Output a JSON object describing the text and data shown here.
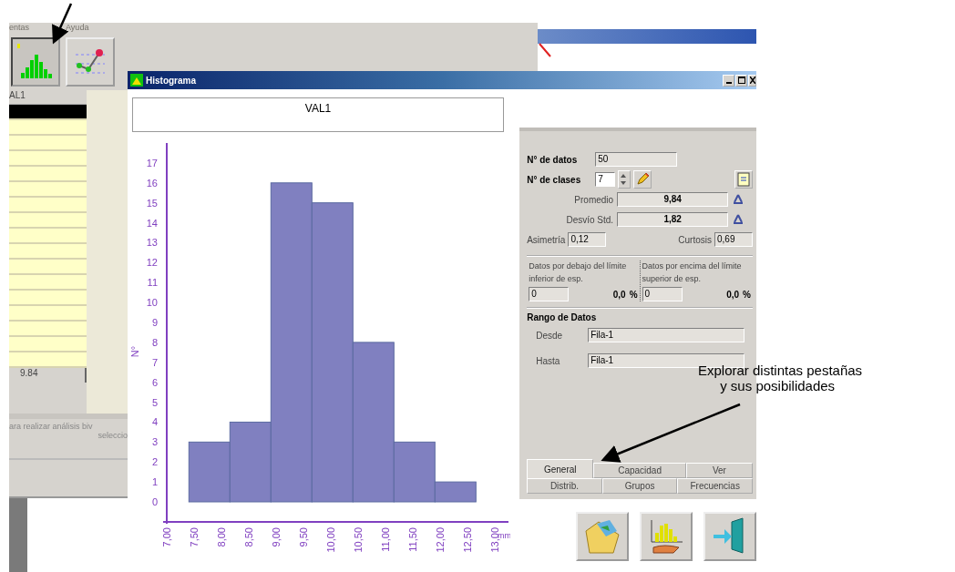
{
  "background_window": {
    "menu": [
      "entas",
      "Ayuda"
    ],
    "toolbar": [
      {
        "kind": "histogram",
        "selected": true
      },
      {
        "kind": "control_chart",
        "selected": false
      }
    ],
    "grid": {
      "column_header": "AL1",
      "rows": [
        {
          "selected": true
        },
        {
          "selected": false
        },
        {
          "selected": false
        },
        {
          "selected": false
        },
        {
          "selected": false
        },
        {
          "selected": false
        },
        {
          "selected": false
        },
        {
          "selected": false
        },
        {
          "selected": false
        },
        {
          "selected": false
        },
        {
          "selected": false
        },
        {
          "selected": false
        },
        {
          "selected": false
        },
        {
          "selected": false
        },
        {
          "selected": false
        },
        {
          "selected": false
        },
        {
          "selected": false
        }
      ],
      "footer": "9.84"
    },
    "hint": [
      "ara realizar análisis biv",
      "seleccio"
    ]
  },
  "histogram_window": {
    "title": "Histograma",
    "chart_title": "VAL1",
    "chart": {
      "chart_data": {
        "type": "bar",
        "ylabel": "N°",
        "xlabel": "mm",
        "x": [
          7.78,
          8.53,
          9.28,
          10.03,
          10.78,
          11.53,
          12.28
        ],
        "values": [
          3,
          4,
          16,
          15,
          8,
          3,
          1
        ],
        "xlim": [
          7,
          13.25
        ],
        "ylim": [
          0,
          18
        ],
        "xticks": [
          {
            "value": 7,
            "label": "7,00"
          },
          {
            "value": 7.5,
            "label": "7,50"
          },
          {
            "value": 8,
            "label": "8,00"
          },
          {
            "value": 8.5,
            "label": "8,50"
          },
          {
            "value": 9,
            "label": "9,00"
          },
          {
            "value": 9.5,
            "label": "9,50"
          },
          {
            "value": 10,
            "label": "10,00"
          },
          {
            "value": 10.5,
            "label": "10,50"
          },
          {
            "value": 11,
            "label": "11,00"
          },
          {
            "value": 11.5,
            "label": "11,50"
          },
          {
            "value": 12,
            "label": "12,00"
          },
          {
            "value": 12.5,
            "label": "12,50"
          },
          {
            "value": 13,
            "label": "13,00"
          }
        ],
        "yticks": [
          0,
          1,
          2,
          3,
          4,
          5,
          6,
          7,
          8,
          9,
          10,
          11,
          12,
          13,
          14,
          15,
          16,
          17
        ]
      }
    },
    "stats": {
      "n_datos_label": "N° de datos",
      "n_datos": "50",
      "n_clases_label": "N° de clases",
      "n_clases": "7",
      "promedio_label": "Promedio",
      "promedio": "9,84",
      "desvio_label": "Desvío Std.",
      "desvio": "1,82",
      "asimetria_label": "Asimetría",
      "asimetria": "0,12",
      "curtosis_label": "Curtosis",
      "curtosis": "0,69"
    },
    "limits": [
      {
        "label": "Datos por debajo del límite inferior de esp.",
        "count": "0",
        "percent": "0,0",
        "unit": "%"
      },
      {
        "label": "Datos por encima del límite superior de esp.",
        "count": "0",
        "percent": "0,0",
        "unit": "%"
      }
    ],
    "range": {
      "title": "Rango de Datos",
      "rows": [
        {
          "label": "Desde",
          "value": "Fila-1"
        },
        {
          "label": "Hasta",
          "value": "Fila-1"
        }
      ]
    },
    "tabs": [
      [
        {
          "label": "General",
          "selected": true
        },
        {
          "label": "Capacidad",
          "selected": false
        },
        {
          "label": "Ver",
          "selected": false
        }
      ],
      [
        {
          "label": "Distrib.",
          "selected": false
        },
        {
          "label": "Grupos",
          "selected": false
        },
        {
          "label": "Frecuencias",
          "selected": false
        }
      ]
    ]
  },
  "callout": [
    "Explorar distintas pestañas",
    "y sus posibilidades"
  ]
}
